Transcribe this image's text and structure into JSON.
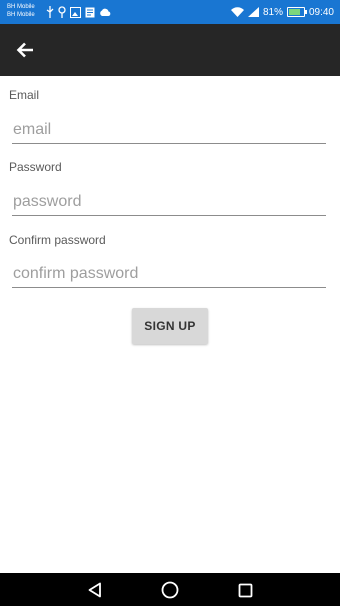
{
  "status_bar": {
    "carrier_line1": "BH Mobile",
    "carrier_line2": "BH Mobile",
    "battery_text": "81%",
    "battery_level": 0.81,
    "time": "09:40",
    "icons": [
      "usb-icon",
      "location-icon",
      "gallery-icon",
      "note-icon",
      "cloud-icon",
      "wifi-icon",
      "signal-icon",
      "battery-icon"
    ]
  },
  "app_bar": {
    "back_icon": "arrow-back-icon"
  },
  "form": {
    "email": {
      "label": "Email",
      "placeholder": "email",
      "value": ""
    },
    "password": {
      "label": "Password",
      "placeholder": "password",
      "value": ""
    },
    "confirm_password": {
      "label": "Confirm password",
      "placeholder": "confirm password",
      "value": ""
    },
    "submit_label": "SIGN UP"
  },
  "nav_bar": {
    "icons": [
      "back-triangle-icon",
      "home-circle-icon",
      "recents-square-icon"
    ]
  },
  "colors": {
    "status_bar": "#1976d2",
    "app_bar": "#262626",
    "button": "#d8d8d8",
    "nav_bar": "#000000"
  }
}
